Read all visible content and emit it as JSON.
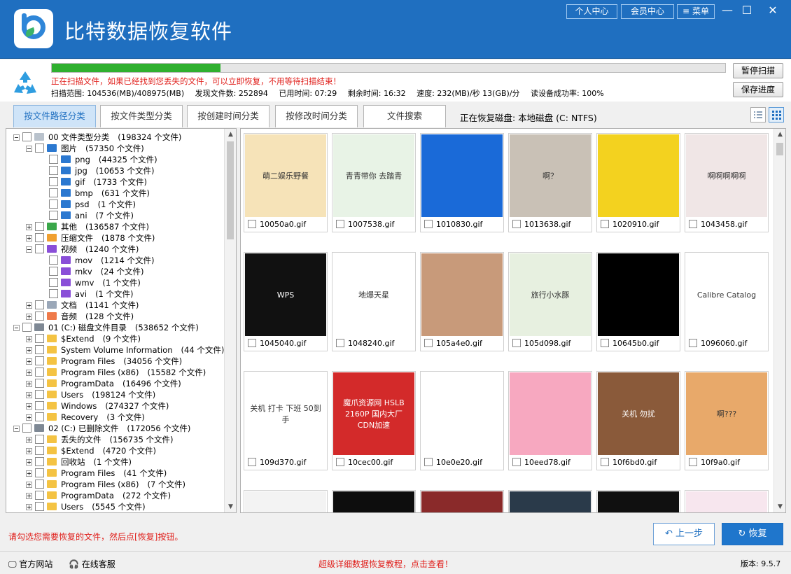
{
  "app": {
    "title": "比特数据恢复软件",
    "btn_personal": "个人中心",
    "btn_member": "会员中心",
    "btn_menu": "菜单"
  },
  "scan": {
    "progress": 0.25,
    "message": "正在扫描文件，如果已经找到您丢失的文件，可以立即恢复，不用等待扫描结束！",
    "range": "扫描范围: 104536(MB)/408975(MB)",
    "found": "发现文件数: 252894",
    "elapsed": "已用时间: 07:29",
    "remaining": "剩余时间: 16:32",
    "speed": "速度: 232(MB)/秒  13(GB)/分",
    "read_rate": "读设备成功率: 100%",
    "btn_pause": "暂停扫描",
    "btn_save": "保存进度"
  },
  "tabs": [
    "按文件路径分类",
    "按文件类型分类",
    "按创建时间分类",
    "按修改时间分类",
    "文件搜索"
  ],
  "disk_info": "正在恢复磁盘: 本地磁盘 (C: NTFS)",
  "tree": [
    {
      "label": "00 文件类型分类",
      "count": "(198324 个文件)"
    },
    {
      "label": "图片",
      "count": "(57350 个文件)"
    },
    {
      "label": "png",
      "count": "(44325 个文件)"
    },
    {
      "label": "jpg",
      "count": "(10653 个文件)"
    },
    {
      "label": "gif",
      "count": "(1733 个文件)"
    },
    {
      "label": "bmp",
      "count": "(631 个文件)"
    },
    {
      "label": "psd",
      "count": "(1 个文件)"
    },
    {
      "label": "ani",
      "count": "(7 个文件)"
    },
    {
      "label": "其他",
      "count": "(136587 个文件)"
    },
    {
      "label": "压缩文件",
      "count": "(1878 个文件)"
    },
    {
      "label": "视频",
      "count": "(1240 个文件)"
    },
    {
      "label": "mov",
      "count": "(1214 个文件)"
    },
    {
      "label": "mkv",
      "count": "(24 个文件)"
    },
    {
      "label": "wmv",
      "count": "(1 个文件)"
    },
    {
      "label": "avi",
      "count": "(1 个文件)"
    },
    {
      "label": "文档",
      "count": "(1141 个文件)"
    },
    {
      "label": "音频",
      "count": "(128 个文件)"
    },
    {
      "label": "01 (C:) 磁盘文件目录",
      "count": "(538652 个文件)"
    },
    {
      "label": "$Extend",
      "count": "(9 个文件)"
    },
    {
      "label": "System Volume Information",
      "count": "(44 个文件)"
    },
    {
      "label": "Program Files",
      "count": "(34056 个文件)"
    },
    {
      "label": "Program Files (x86)",
      "count": "(15582 个文件)"
    },
    {
      "label": "ProgramData",
      "count": "(16496 个文件)"
    },
    {
      "label": "Users",
      "count": "(198124 个文件)"
    },
    {
      "label": "Windows",
      "count": "(274327 个文件)"
    },
    {
      "label": "Recovery",
      "count": "(3 个文件)"
    },
    {
      "label": "02 (C:) 已删除文件",
      "count": "(172056 个文件)"
    },
    {
      "label": "丢失的文件",
      "count": "(156735 个文件)"
    },
    {
      "label": "$Extend",
      "count": "(4720 个文件)"
    },
    {
      "label": "回收站",
      "count": "(1 个文件)"
    },
    {
      "label": "Program Files",
      "count": "(41 个文件)"
    },
    {
      "label": "Program Files (x86)",
      "count": "(7 个文件)"
    },
    {
      "label": "ProgramData",
      "count": "(272 个文件)"
    },
    {
      "label": "Users",
      "count": "(5545 个文件)"
    }
  ],
  "files": [
    {
      "name": "10050a0.gif",
      "thumb_text": "萌二娱乐野餐",
      "color": "#f6e3b8"
    },
    {
      "name": "1007538.gif",
      "thumb_text": "青青带你 去踏青",
      "color": "#e8f3e6"
    },
    {
      "name": "1010830.gif",
      "thumb_text": "",
      "color": "#1a6ad8"
    },
    {
      "name": "1013638.gif",
      "thumb_text": "啊？",
      "color": "#c9c1b6"
    },
    {
      "name": "1020910.gif",
      "thumb_text": "",
      "color": "#f3d21f"
    },
    {
      "name": "1043458.gif",
      "thumb_text": "啊啊啊啊啊",
      "color": "#f0e6e6"
    },
    {
      "name": "1045040.gif",
      "thumb_text": "WPS",
      "color": "#111111"
    },
    {
      "name": "1048240.gif",
      "thumb_text": "地爆天星",
      "color": "#ffffff"
    },
    {
      "name": "105a4e0.gif",
      "thumb_text": "",
      "color": "#c89a7a"
    },
    {
      "name": "105d098.gif",
      "thumb_text": "旅行小水豚",
      "color": "#e7f0e0"
    },
    {
      "name": "10645b0.gif",
      "thumb_text": "",
      "color": "#000000"
    },
    {
      "name": "1096060.gif",
      "thumb_text": "Calibre Catalog",
      "color": "#ffffff"
    },
    {
      "name": "109d370.gif",
      "thumb_text": "关机 打卡 下班 50到手",
      "color": "#ffffff"
    },
    {
      "name": "10cec00.gif",
      "thumb_text": "魔爪资源网 HSLB 2160P 国内大厂 CDN加速",
      "color": "#d32a2a"
    },
    {
      "name": "10e0e20.gif",
      "thumb_text": "",
      "color": "#ffffff"
    },
    {
      "name": "10eed78.gif",
      "thumb_text": "",
      "color": "#f7a8c0"
    },
    {
      "name": "10f6bd0.gif",
      "thumb_text": "关机 勿扰",
      "color": "#8a5a3a"
    },
    {
      "name": "10f9a0.gif",
      "thumb_text": "啊???",
      "color": "#e8a96a"
    },
    {
      "name": "",
      "thumb_text": "",
      "color": "#f3f3f3"
    },
    {
      "name": "",
      "thumb_text": "",
      "color": "#0d0d0d"
    },
    {
      "name": "",
      "thumb_text": "",
      "color": "#8a2a2a"
    },
    {
      "name": "",
      "thumb_text": "",
      "color": "#2a3a4a"
    },
    {
      "name": "",
      "thumb_text": "",
      "color": "#101010"
    },
    {
      "name": "",
      "thumb_text": "",
      "color": "#f7e6ee"
    }
  ],
  "hint": "请勾选您需要恢复的文件，然后点[恢复]按钮。",
  "btn_back": "上一步",
  "btn_recover": "恢复",
  "footer": {
    "website": "官方网站",
    "support": "在线客服",
    "tutorial": "超级详细数据恢复教程，点击查看！",
    "version": "版本: 9.5.7"
  },
  "colors": {
    "brand": "#1f6fc0",
    "progress": "#2fb02f",
    "alert": "#e0201c"
  }
}
